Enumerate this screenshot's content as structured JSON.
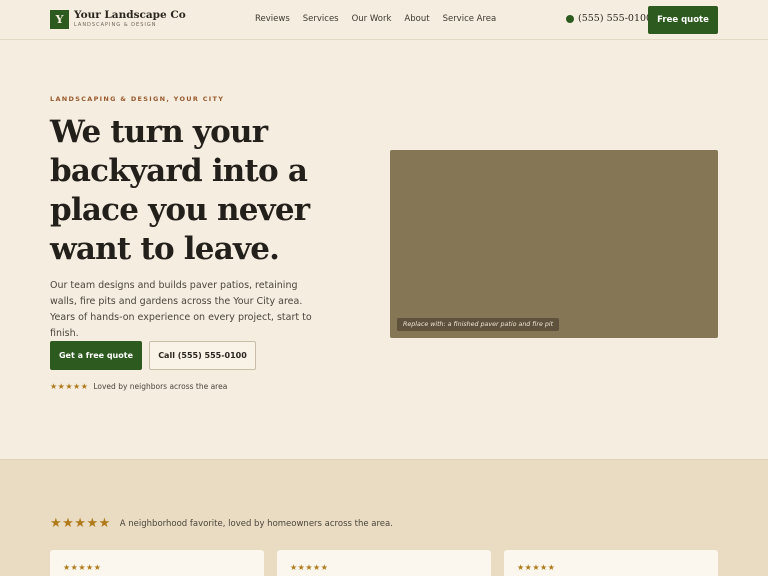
{
  "header": {
    "logo_letter": "Y",
    "brand_name": "Your Landscape Co",
    "brand_tagline": "LANDSCAPING & DESIGN",
    "nav": [
      "Reviews",
      "Services",
      "Our Work",
      "About",
      "Service Area"
    ],
    "phone": "(555) 555-0100",
    "cta_label": "Free quote"
  },
  "hero": {
    "eyebrow": "LANDSCAPING & DESIGN, YOUR CITY",
    "headline": "We turn your backyard into a place you never want to leave.",
    "lede": "Our team designs and builds paver patios, retaining walls, fire pits and gardens across the Your City area. Years of hands-on experience on every project, start to finish.",
    "primary_cta": "Get a free quote",
    "secondary_cta": "Call (555) 555-0100",
    "rating_stars": "★★★★★",
    "rating_text": "Loved by neighbors across the area",
    "image_caption": "Replace with: a finished paver patio and fire pit"
  },
  "reviews": {
    "stars": "★★★★★",
    "summary": "A neighborhood favorite, loved by homeowners across the area.",
    "cards": [
      {
        "stars": "★★★★★"
      },
      {
        "stars": "★★★★★"
      },
      {
        "stars": "★★★★★"
      }
    ]
  },
  "colors": {
    "brand_green": "#2d5a1f",
    "background": "#f5eddf",
    "band": "#e9dcc3",
    "star_gold": "#b07a1a",
    "eyebrow_rust": "#9a5a2f"
  }
}
